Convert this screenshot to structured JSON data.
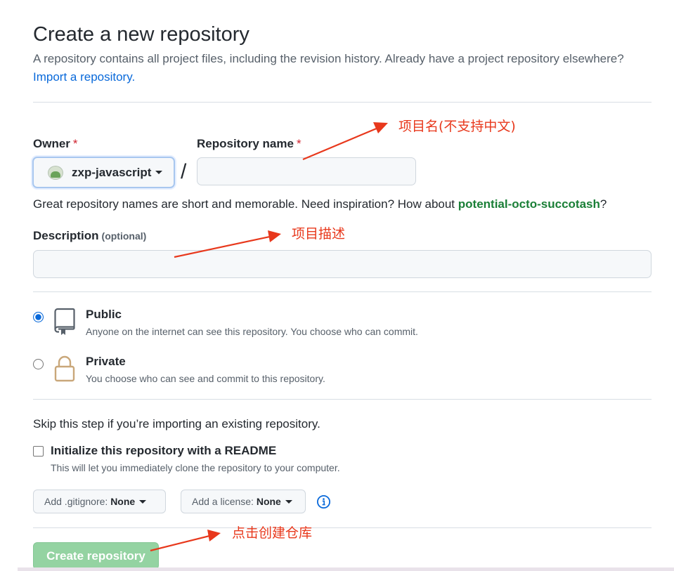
{
  "page": {
    "title": "Create a new repository",
    "subtitle": "A repository contains all project files, including the revision history. Already have a project repository elsewhere?",
    "import_link": "Import a repository."
  },
  "owner": {
    "label": "Owner",
    "required_mark": "*",
    "value": "zxp-javascript",
    "avatar_icon": "avatar-icon"
  },
  "repo_name": {
    "label": "Repository name",
    "required_mark": "*",
    "value": "",
    "separator": "/"
  },
  "name_hint": {
    "prefix": "Great repository names are short and memorable. Need inspiration? How about ",
    "suggestion": "potential-octo-succotash",
    "suffix": "?"
  },
  "description": {
    "label": "Description",
    "optional": "(optional)",
    "value": ""
  },
  "visibility": {
    "options": [
      {
        "title": "Public",
        "desc": "Anyone on the internet can see this repository. You choose who can commit.",
        "checked": true,
        "icon": "repo-icon"
      },
      {
        "title": "Private",
        "desc": "You choose who can see and commit to this repository.",
        "checked": false,
        "icon": "lock-icon"
      }
    ]
  },
  "init": {
    "skip_text": "Skip this step if you’re importing an existing repository.",
    "readme_label": "Initialize this repository with a README",
    "readme_desc": "This will let you immediately clone the repository to your computer."
  },
  "selects": {
    "gitignore_label": "Add .gitignore:",
    "gitignore_value": "None",
    "license_label": "Add a license:",
    "license_value": "None",
    "info_icon": "info-icon"
  },
  "create_button": "Create repository",
  "annotations": {
    "repo_name": "项目名(不支持中文)",
    "description": "项目描述",
    "create": "点击创建仓库"
  },
  "colors": {
    "link": "#0969da",
    "suggestion": "#1a7f37",
    "required": "#cf222e",
    "create_button_bg": "#94d3a2",
    "annotation": "#e8381c"
  }
}
